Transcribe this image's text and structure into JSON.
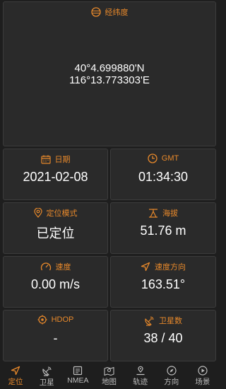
{
  "lat_lng": {
    "title": "经纬度",
    "lat": "40°4.699880'N",
    "lng": "116°13.773303'E"
  },
  "cards": {
    "date": {
      "label": "日期",
      "value": "2021-02-08"
    },
    "gmt": {
      "label": "GMT",
      "value": "01:34:30"
    },
    "mode": {
      "label": "定位模式",
      "value": "已定位"
    },
    "alt": {
      "label": "海拔",
      "value": "51.76 m"
    },
    "speed": {
      "label": "速度",
      "value": "0.00 m/s"
    },
    "course": {
      "label": "速度方向",
      "value": "163.51°"
    },
    "hdop": {
      "label": "HDOP",
      "value": "-"
    },
    "sats": {
      "label": "卫星数",
      "value": "38 / 40"
    }
  },
  "nav": {
    "items": [
      {
        "label": "定位",
        "icon": "locate-arrow-icon",
        "active": true
      },
      {
        "label": "卫星",
        "icon": "satellite-icon"
      },
      {
        "label": "NMEA",
        "icon": "document-icon"
      },
      {
        "label": "地图",
        "icon": "map-icon"
      },
      {
        "label": "轨迹",
        "icon": "track-icon"
      },
      {
        "label": "方向",
        "icon": "compass-icon"
      },
      {
        "label": "场景",
        "icon": "play-icon"
      }
    ]
  },
  "colors": {
    "accent": "#e8892b",
    "background": "#1e1e1e",
    "card": "#2a2a2a",
    "border": "#3c3c3c",
    "nav_inactive": "#bdbdbd"
  }
}
